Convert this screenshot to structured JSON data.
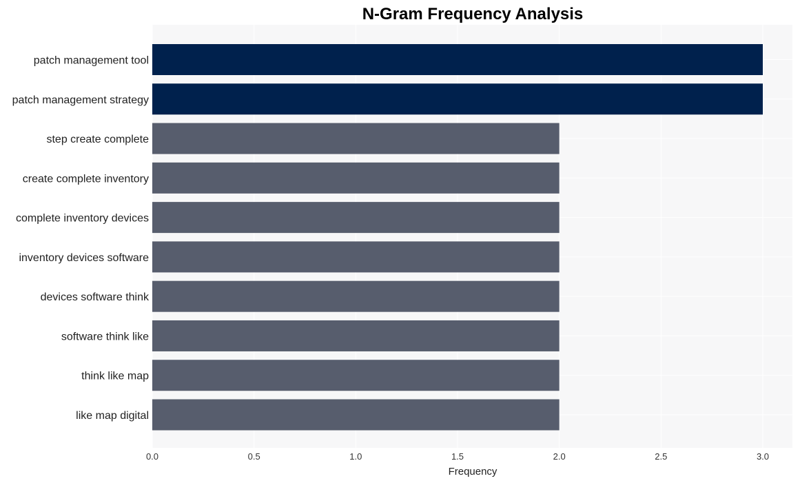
{
  "chart_data": {
    "type": "bar",
    "orientation": "horizontal",
    "title": "N-Gram Frequency Analysis",
    "xlabel": "Frequency",
    "ylabel": "",
    "xlim": [
      0,
      3.15
    ],
    "xticks": [
      0.0,
      0.5,
      1.0,
      1.5,
      2.0,
      2.5,
      3.0
    ],
    "xtick_labels": [
      "0.0",
      "0.5",
      "1.0",
      "1.5",
      "2.0",
      "2.5",
      "3.0"
    ],
    "grid": true,
    "categories": [
      "patch management tool",
      "patch management strategy",
      "step create complete",
      "create complete inventory",
      "complete inventory devices",
      "inventory devices software",
      "devices software think",
      "software think like",
      "think like map",
      "like map digital"
    ],
    "values": [
      3,
      3,
      2,
      2,
      2,
      2,
      2,
      2,
      2,
      2
    ],
    "colors": {
      "highlight": "#00214d",
      "default": "#575d6d",
      "plot_background": "#f7f7f8",
      "grid": "#ffffff"
    }
  }
}
